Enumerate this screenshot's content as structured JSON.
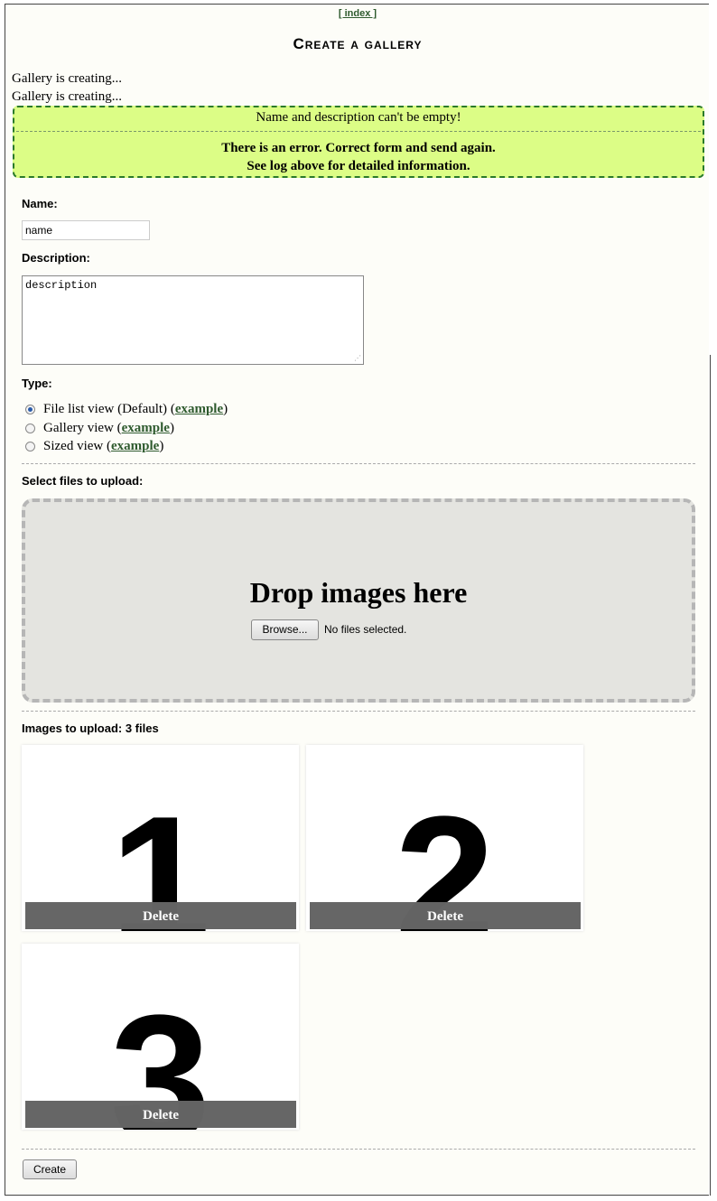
{
  "nav": {
    "index_link": "[ index ]"
  },
  "page": {
    "title": "Create a gallery"
  },
  "log": [
    "Gallery is creating...",
    "Gallery is creating..."
  ],
  "error": {
    "message": "Name and description can't be empty!",
    "summary_line1": "There is an error. Correct form and send again.",
    "summary_line2": "See log above for detailed information."
  },
  "form": {
    "name_label": "Name:",
    "name_value": "name",
    "description_label": "Description:",
    "description_value": "description",
    "type_label": "Type:",
    "types": [
      {
        "label": "File list view (Default)",
        "link": "example",
        "checked": true
      },
      {
        "label": "Gallery view",
        "link": "example",
        "checked": false
      },
      {
        "label": "Sized view",
        "link": "example",
        "checked": false
      }
    ],
    "select_files_label": "Select files to upload:",
    "drop_title": "Drop images here",
    "browse_label": "Browse...",
    "no_files": "No files selected.",
    "images_to_upload": "Images to upload: 3 files",
    "images": [
      {
        "digit": "1",
        "delete_label": "Delete"
      },
      {
        "digit": "2",
        "delete_label": "Delete"
      },
      {
        "digit": "3",
        "delete_label": "Delete"
      }
    ],
    "create_label": "Create"
  },
  "colors": {
    "error_bg": "#dcfd86",
    "error_border": "#2a7a2a",
    "link": "#2e5a2e",
    "page_bg": "#fdfdf8",
    "dropzone_bg": "#e4e4e0"
  }
}
